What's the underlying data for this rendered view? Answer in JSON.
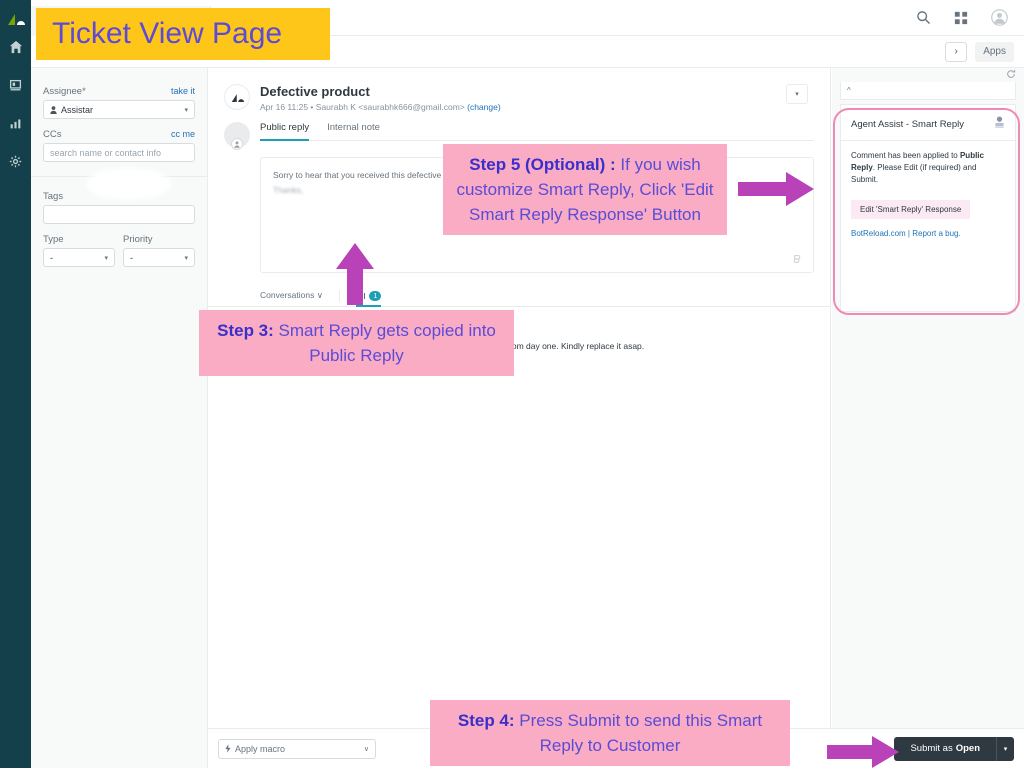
{
  "annotations": {
    "banner": "Ticket View Page",
    "step3": {
      "bold": "Step 3:",
      "text": " Smart Reply gets copied into Public Reply"
    },
    "step4": {
      "bold": "Step 4:",
      "text": " Press Submit to send this Smart Reply to Customer"
    },
    "step5": {
      "bold": "Step 5 (Optional) :",
      "text": " If you wish customize Smart Reply, Click 'Edit Smart Reply Response' Button"
    }
  },
  "colors": {
    "callout_bg": "#f9acc4",
    "callout_text": "#5b4bd6",
    "banner_bg": "#ffc61a",
    "arrow": "#b942b9",
    "ring": "#f08ab4",
    "rail": "#13404a",
    "accent_teal": "#1f9fb5",
    "link_blue": "#1f73b7",
    "submit_bg": "#2f3941"
  },
  "rail": {
    "logo_icon": "zendesk-logo-icon",
    "items": [
      {
        "icon": "home-icon",
        "name": "home"
      },
      {
        "icon": "views-icon",
        "name": "views"
      },
      {
        "icon": "reporting-icon",
        "name": "reporting"
      },
      {
        "icon": "gear-icon",
        "name": "admin"
      }
    ]
  },
  "topbar": {
    "tab_label": "",
    "icons": [
      {
        "icon": "search-icon",
        "name": "search"
      },
      {
        "icon": "grid-apps-icon",
        "name": "products"
      },
      {
        "icon": "avatar-icon",
        "name": "user-profile"
      }
    ]
  },
  "subbar": {
    "expand_label": "›",
    "apps_label": "Apps"
  },
  "properties": {
    "assignee": {
      "label": "Assignee*",
      "action": "take it",
      "value": "Assistar",
      "icon": "person-icon"
    },
    "ccs": {
      "label": "CCs",
      "action": "cc me",
      "placeholder": "search name or contact info",
      "value": ""
    },
    "tags": {
      "label": "Tags",
      "value": ""
    },
    "type": {
      "label": "Type",
      "value": "-"
    },
    "priority": {
      "label": "Priority",
      "value": "-"
    }
  },
  "ticket": {
    "title": "Defective product",
    "meta_date": "Apr 16 11:25",
    "meta_sep": "•",
    "meta_requester": "Saurabh K <saurabhk666@gmail.com>",
    "meta_change": "(change)",
    "header_menu_icon": "chevron-down-icon"
  },
  "composer": {
    "tabs": [
      {
        "label": "Public reply",
        "active": true
      },
      {
        "label": "Internal note",
        "active": false
      }
    ],
    "body_line1": "Sorry to hear that you received this defective product. ’",
    "body_line2": "Thanks,",
    "tool_icon": "rich-text-icon"
  },
  "conversations": {
    "selector_label": "Conversations",
    "selector_caret": "∨",
    "tab_label": "All",
    "tab_count": "1",
    "messages": [
      {
        "timestamp": "r 16 11:25",
        "text": "I have received this defective product. It has been malfunctioning from day one. Kindly replace it asap."
      }
    ]
  },
  "bottombar": {
    "macro_label": "Apply macro",
    "macro_icon": "lightning-icon",
    "macro_caret": "∨",
    "ghost_label": "",
    "submit_prefix": "Submit as ",
    "submit_status": "Open",
    "submit_caret": "∨"
  },
  "agent_assist": {
    "collapse_icon": "chevron-up-icon",
    "refresh_icon": "refresh-icon",
    "title": "Agent Assist - Smart Reply",
    "header_icon": "bot-avatar-icon",
    "message_pre": "Comment has been applied to ",
    "message_bold": "Public Reply",
    "message_post": ". Please Edit (if required) and Submit.",
    "edit_button": "Edit 'Smart Reply' Response",
    "link_primary": "BotReload.com",
    "link_sep": " | ",
    "link_secondary": "Report a bug."
  }
}
